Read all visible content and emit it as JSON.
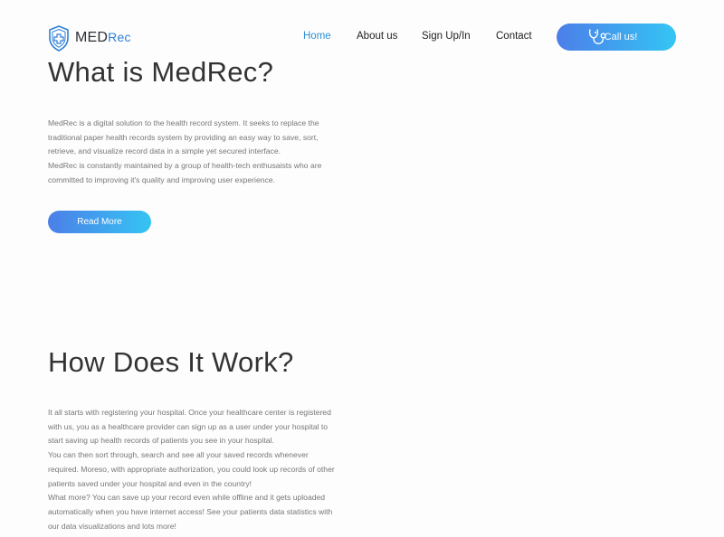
{
  "brand": {
    "med": "MED",
    "rec": "Rec"
  },
  "nav": {
    "items": [
      {
        "label": "Home",
        "active": true
      },
      {
        "label": "About us",
        "active": false
      },
      {
        "label": "Sign Up/In",
        "active": false
      },
      {
        "label": "Contact",
        "active": false
      }
    ],
    "cta_label": "Call us!"
  },
  "about": {
    "title": "What is MedRec?",
    "paragraph_lines": [
      "MedRec is a digital solution to the health record system. It seeks to replace the",
      "traditional paper health records system by providing an easy way to save, sort,",
      "retrieve, and visualize record data in a simple yet secured interface.",
      "MedRec is constantly maintained by a group of health-tech enthusaists who are",
      "committed to improving it's quality and improving user experience."
    ],
    "button_label": "Read More"
  },
  "how": {
    "title": "How Does It Work?",
    "paragraph_lines": [
      "It all starts with registering your hospital. Once your healthcare center is registered",
      "with us, you as a healthcare provider can sign up as a user under your hospital to",
      "start saving up health records of patients you see in your hospital.",
      "You can then sort through, search and see all your saved records whenever",
      "required. Moreso, with appropriate authorization, you could look up records of other",
      "patients saved under your hospital and even in the country!",
      "What more? You can save up your record even while offline and it gets uploaded",
      "automatically when you have internet access! See your patients data statistics with",
      "our data visualizations and lots more!"
    ]
  },
  "colors": {
    "accent": "#2e8fd6",
    "gradient_start": "#4c7ee8",
    "gradient_end": "#34c5f4",
    "heading": "#333333",
    "body_text": "#777777"
  },
  "icons": {
    "logo": "shield-cross-icon",
    "call": "stethoscope-icon"
  }
}
